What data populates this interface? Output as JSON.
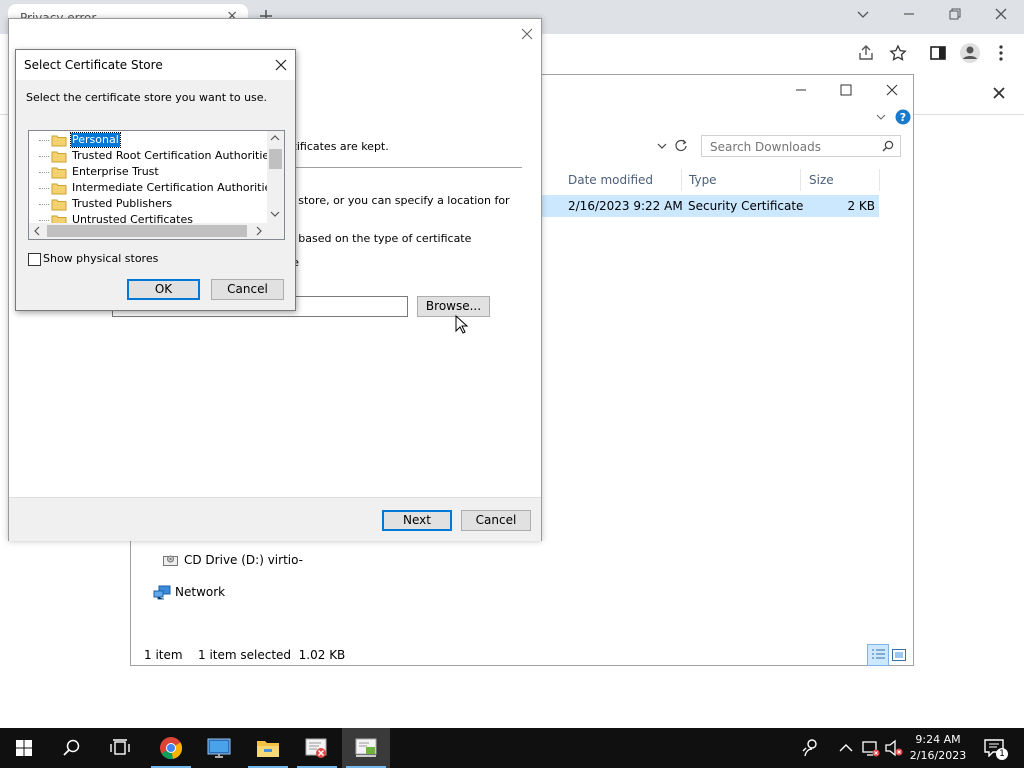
{
  "chrome": {
    "tab_title": "Privacy error",
    "tab_close": "×"
  },
  "explorer": {
    "search_placeholder": "Search Downloads",
    "columns": {
      "date": "Date modified",
      "type": "Type",
      "size": "Size"
    },
    "file": {
      "date": "2/16/2023 9:22 AM",
      "type": "Security Certificate",
      "size": "2 KB"
    },
    "nav": {
      "cd_drive": "CD Drive (D:) virtio-",
      "network": "Network"
    },
    "status": {
      "count": "1 item",
      "selected": "1 item selected  1.02 KB"
    }
  },
  "wizard": {
    "line1": "rtificates are kept.",
    "line2": "e store, or you can specify a location for",
    "line3": "e based on the type of certificate",
    "line4": "re",
    "browse_label": "Browse...",
    "next_label": "Next",
    "cancel_label": "Cancel"
  },
  "store_dialog": {
    "title": "Select Certificate Store",
    "prompt": "Select the certificate store you want to use.",
    "items": [
      "Personal",
      "Trusted Root Certification Authorities",
      "Enterprise Trust",
      "Intermediate Certification Authorities",
      "Trusted Publishers",
      "Untrusted Certificates"
    ],
    "show_physical": "Show physical stores",
    "ok_label": "OK",
    "cancel_label": "Cancel"
  },
  "taskbar": {
    "time": "9:24 AM",
    "date": "2/16/2023",
    "notification_count": "1"
  }
}
